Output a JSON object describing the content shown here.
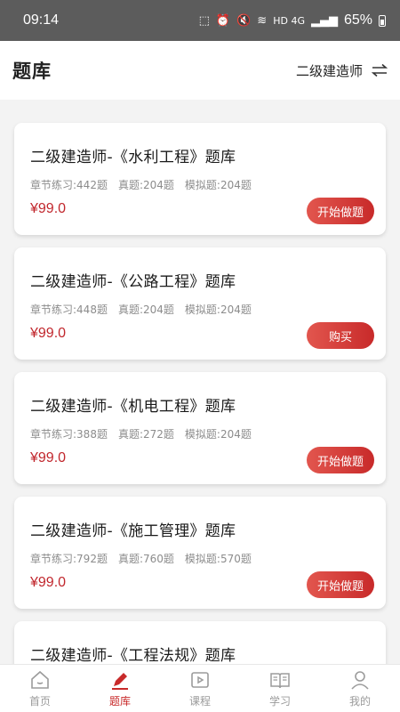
{
  "status_bar": {
    "time": "09:14",
    "network": "HD 4G",
    "battery": "65%"
  },
  "header": {
    "title": "题库",
    "switch_label": "二级建造师"
  },
  "cards": [
    {
      "title": "二级建造师-《水利工程》题库",
      "chapter": "章节练习:442题",
      "real": "真题:204题",
      "mock": "模拟题:204题",
      "price": "¥99.0",
      "action": "开始做题"
    },
    {
      "title": "二级建造师-《公路工程》题库",
      "chapter": "章节练习:448题",
      "real": "真题:204题",
      "mock": "模拟题:204题",
      "price": "¥99.0",
      "action": "购买"
    },
    {
      "title": "二级建造师-《机电工程》题库",
      "chapter": "章节练习:388题",
      "real": "真题:272题",
      "mock": "模拟题:204题",
      "price": "¥99.0",
      "action": "开始做题"
    },
    {
      "title": "二级建造师-《施工管理》题库",
      "chapter": "章节练习:792题",
      "real": "真题:760题",
      "mock": "模拟题:570题",
      "price": "¥99.0",
      "action": "开始做题"
    },
    {
      "title": "二级建造师-《工程法规》题库"
    }
  ],
  "tabs": [
    {
      "label": "首页",
      "icon": "home-icon"
    },
    {
      "label": "题库",
      "icon": "pen-icon",
      "active": true
    },
    {
      "label": "课程",
      "icon": "video-icon"
    },
    {
      "label": "学习",
      "icon": "book-icon"
    },
    {
      "label": "我的",
      "icon": "user-icon"
    }
  ],
  "colors": {
    "accent": "#c82a2a",
    "price": "#c1272d",
    "inactive_tab": "#9b9b9b"
  }
}
